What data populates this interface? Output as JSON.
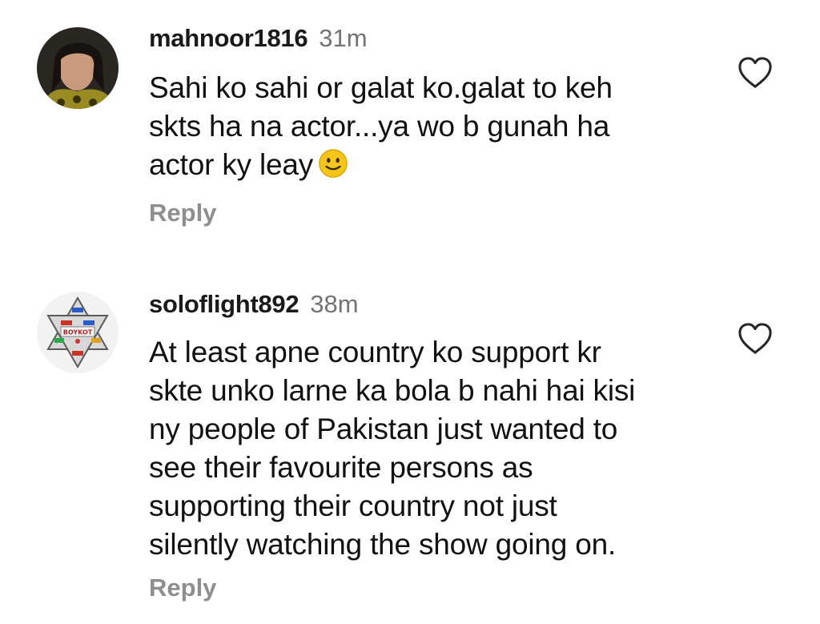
{
  "comments": [
    {
      "username": "mahnoor1816",
      "time": "31m",
      "lines": [
        "Sahi ko sahi or galat ko.galat to keh",
        "skts ha na actor...ya wo b gunah ha",
        "actor ky leay"
      ],
      "emoji": "slightly-smiling-face",
      "reply_label": "Reply",
      "like_icon": "heart-outline-icon"
    },
    {
      "username": "soloflight892",
      "time": "38m",
      "avatar_text": "BOYKOT",
      "lines": [
        "At least apne country ko support kr",
        "skte unko larne ka bola b nahi hai kisi",
        "ny people of Pakistan just wanted to",
        "see their favourite persons as",
        "supporting their country not just",
        "silently watching the show going on."
      ],
      "reply_label": "Reply",
      "like_icon": "heart-outline-icon"
    }
  ],
  "colors": {
    "text": "#111111",
    "muted": "#737373",
    "reply": "#8e8e8e",
    "emoji": "#f5c518"
  }
}
